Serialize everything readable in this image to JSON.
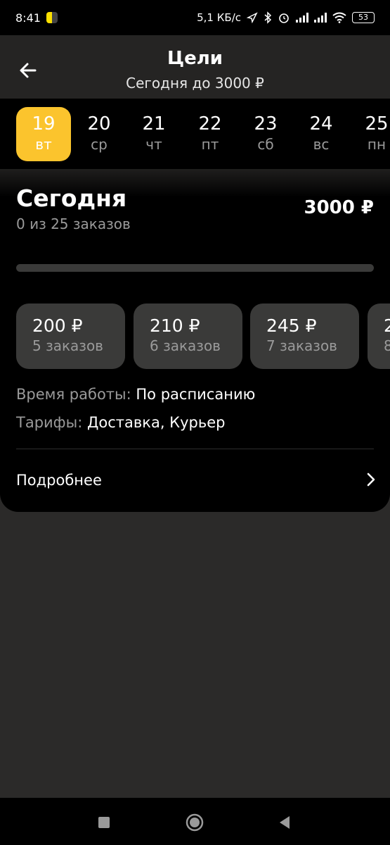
{
  "status_bar": {
    "time": "8:41",
    "net_speed": "5,1 КБ/с",
    "battery": "53"
  },
  "header": {
    "title": "Цели",
    "subtitle": "Сегодня до 3000 ₽"
  },
  "days": [
    {
      "num": "19",
      "dow": "вт",
      "active": true
    },
    {
      "num": "20",
      "dow": "ср",
      "active": false
    },
    {
      "num": "21",
      "dow": "чт",
      "active": false
    },
    {
      "num": "22",
      "dow": "пт",
      "active": false
    },
    {
      "num": "23",
      "dow": "сб",
      "active": false
    },
    {
      "num": "24",
      "dow": "вс",
      "active": false
    },
    {
      "num": "25",
      "dow": "пн",
      "active": false
    }
  ],
  "today": {
    "title": "Сегодня",
    "orders": "0 из 25 заказов",
    "amount": "3000 ₽",
    "progress": 0
  },
  "tiers": [
    {
      "price": "200 ₽",
      "count": "5 заказов"
    },
    {
      "price": "210 ₽",
      "count": "6 заказов"
    },
    {
      "price": "245 ₽",
      "count": "7 заказов"
    },
    {
      "price": "2",
      "count": "8"
    }
  ],
  "info": {
    "work_time_label": "Время работы:",
    "work_time_value": "По расписанию",
    "tariffs_label": "Тарифы:",
    "tariffs_value": "Доставка, Курьер"
  },
  "more_label": "Подробнее",
  "colors": {
    "accent": "#fbc42d",
    "background": "#2b2a29",
    "card": "#000000",
    "tile": "#3a3a39",
    "muted_text": "#9a9a9a"
  },
  "icons": {
    "back": "arrow-left-icon",
    "more": "chevron-right-icon",
    "nav_recent": "square-icon",
    "nav_home": "circle-icon",
    "nav_back": "triangle-left-icon"
  }
}
